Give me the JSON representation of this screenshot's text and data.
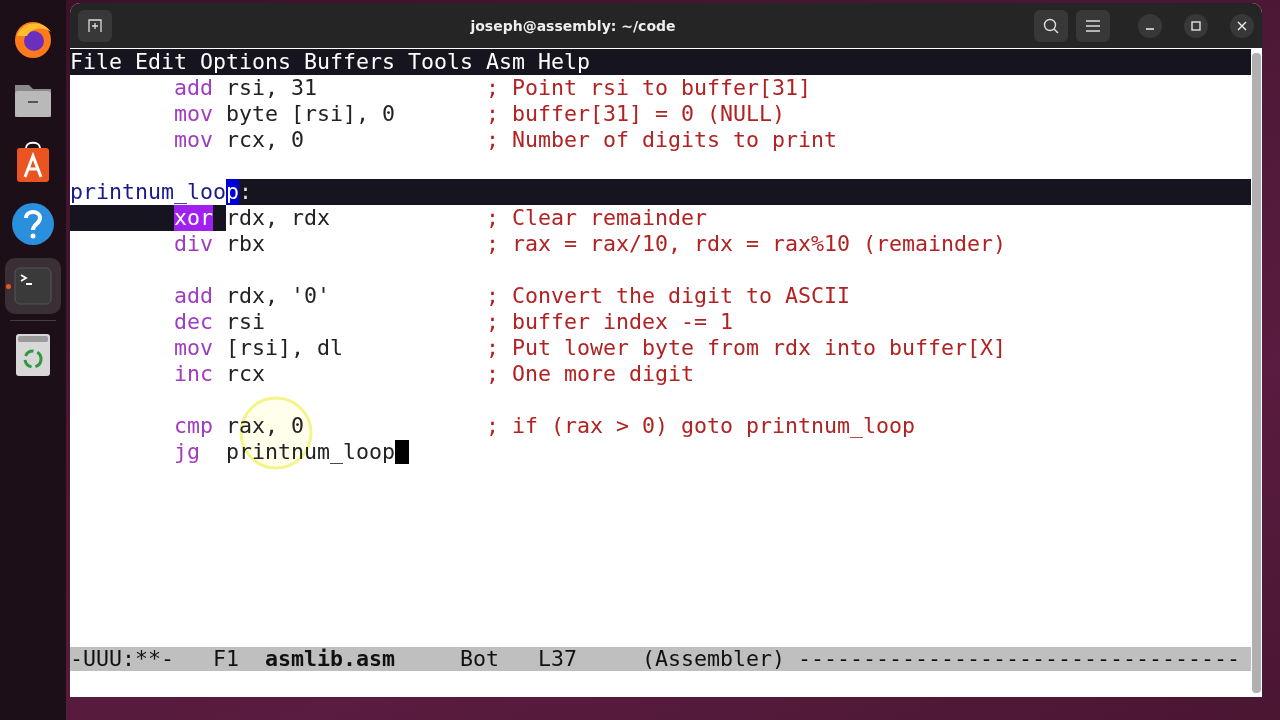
{
  "window": {
    "title": "joseph@assembly: ~/code"
  },
  "menu": [
    "File",
    "Edit",
    "Options",
    "Buffers",
    "Tools",
    "Asm",
    "Help"
  ],
  "lines": [
    {
      "kind": "code",
      "opcode": "add",
      "operands": "rsi, 31",
      "comment": "; Point rsi to buffer[31]",
      "region": false,
      "cursor": false
    },
    {
      "kind": "code",
      "opcode": "mov",
      "operands": "byte [rsi], 0",
      "comment": "; buffer[31] = 0 (NULL)",
      "region": false,
      "cursor": false
    },
    {
      "kind": "code",
      "opcode": "mov",
      "operands": "rcx, 0",
      "comment": "; Number of digits to print",
      "region": false,
      "cursor": false
    },
    {
      "kind": "blank"
    },
    {
      "kind": "label",
      "label": "printnum_loo",
      "point": "p",
      "suffix": ":",
      "region": true
    },
    {
      "kind": "code",
      "opcode": "xor",
      "operands": "rdx, rdx",
      "comment": "; Clear remainder",
      "region": true,
      "cursor": false
    },
    {
      "kind": "code",
      "opcode": "div",
      "operands": "rbx",
      "comment": "; rax = rax/10, rdx = rax%10 (remainder)",
      "region": false,
      "cursor": false
    },
    {
      "kind": "blank"
    },
    {
      "kind": "code",
      "opcode": "add",
      "operands": "rdx, '0'",
      "comment": "; Convert the digit to ASCII",
      "region": false,
      "cursor": false
    },
    {
      "kind": "code",
      "opcode": "dec",
      "operands": "rsi",
      "comment": "; buffer index -= 1",
      "region": false,
      "cursor": false
    },
    {
      "kind": "code",
      "opcode": "mov",
      "operands": "[rsi], dl",
      "comment": "; Put lower byte from rdx into buffer[X]",
      "region": false,
      "cursor": false
    },
    {
      "kind": "code",
      "opcode": "inc",
      "operands": "rcx",
      "comment": "; One more digit",
      "region": false,
      "cursor": false
    },
    {
      "kind": "blank"
    },
    {
      "kind": "code",
      "opcode": "cmp",
      "operands": "rax, 0",
      "comment": "; if (rax > 0) goto printnum_loop",
      "region": false,
      "cursor": false
    },
    {
      "kind": "code",
      "opcode": "jg",
      "operands": "printnum_loop",
      "region": false,
      "cursor": true
    }
  ],
  "mode_line": {
    "state": "-UUU:**-",
    "frame": "F1",
    "buffer": "asmlib.asm",
    "position": "Bot",
    "line": "L37",
    "mode": "(Assembler)",
    "fill": "----------------------------------"
  },
  "dock": [
    {
      "kind": "browser",
      "active": false
    },
    {
      "kind": "files",
      "active": false
    },
    {
      "kind": "store",
      "active": false
    },
    {
      "kind": "help",
      "active": false
    },
    {
      "kind": "terminal",
      "active": true
    },
    {
      "kind": "trash",
      "active": false
    }
  ]
}
